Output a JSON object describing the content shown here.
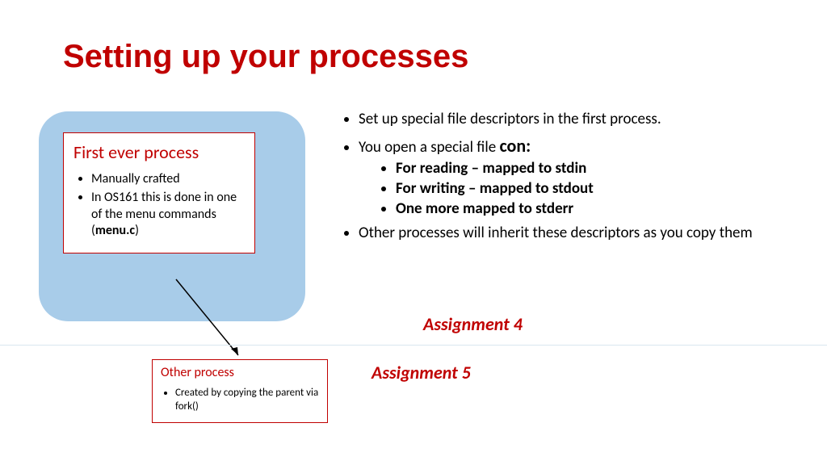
{
  "title": "Setting up your processes",
  "first_process": {
    "heading": "First ever process",
    "items": [
      "Manually crafted",
      "In OS161 this is done in one of the menu commands (",
      "menu.c",
      ")"
    ]
  },
  "other_process": {
    "heading": "Other process",
    "items": [
      "Created by copying the parent via fork()"
    ]
  },
  "right": {
    "line1": "Set up special file descriptors in the first process.",
    "line2_prefix": "You open a special file ",
    "line2_con": "con:",
    "sub1": "For reading – mapped to stdin",
    "sub2": "For writing – mapped to stdout",
    "sub3": "One more mapped to stderr",
    "line3": "Other processes will inherit these descriptors as you copy them"
  },
  "assign4": "Assignment 4",
  "assign5": "Assignment 5"
}
